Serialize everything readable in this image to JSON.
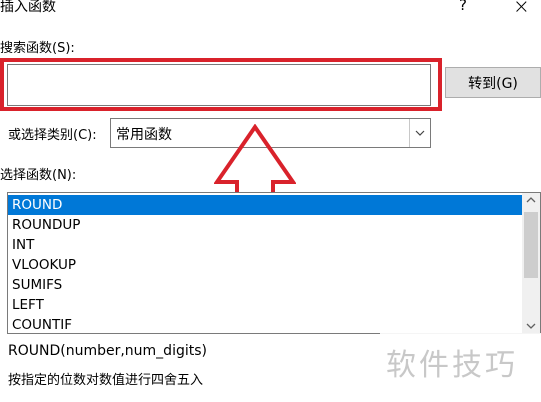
{
  "dialog": {
    "title": "插入函数",
    "help": "?",
    "close": "×"
  },
  "search": {
    "label": "搜索函数(S):",
    "value": "",
    "goto_label": "转到(G)"
  },
  "category": {
    "label": "或选择类别(C):",
    "selected": "常用函数"
  },
  "function_list": {
    "label": "选择函数(N):",
    "items": [
      "ROUND",
      "ROUNDUP",
      "INT",
      "VLOOKUP",
      "SUMIFS",
      "LEFT",
      "COUNTIF"
    ],
    "selected_index": 0
  },
  "details": {
    "syntax": "ROUND(number,num_digits)",
    "description": "按指定的位数对数值进行四舍五入"
  },
  "watermark": "软件技巧",
  "colors": {
    "annotation_red": "#d9222b",
    "selection_blue": "#0078d7"
  }
}
